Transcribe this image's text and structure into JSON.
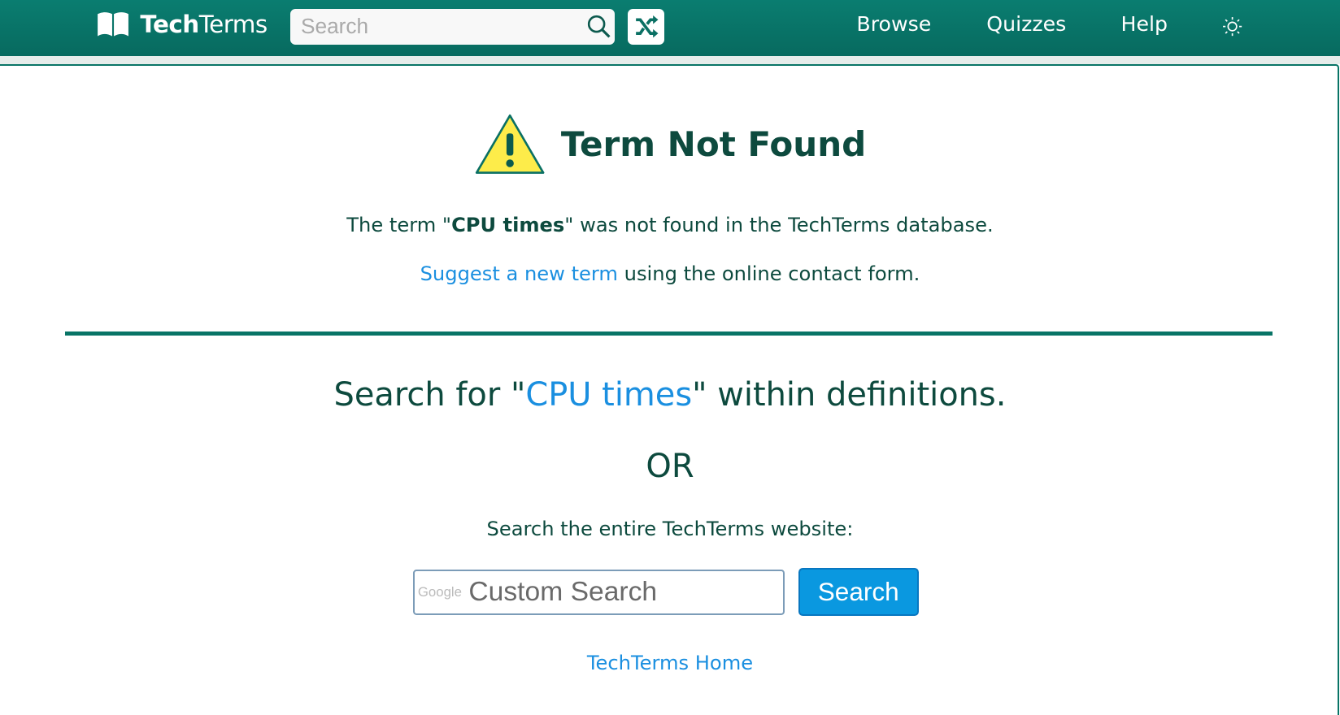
{
  "header": {
    "logo_bold": "Tech",
    "logo_light": "Terms",
    "search_placeholder": "Search",
    "nav": [
      "Browse",
      "Quizzes",
      "Help"
    ],
    "icons": {
      "logo": "book-icon",
      "search": "magnifier-icon",
      "random": "shuffle-icon",
      "theme": "sun-icon"
    }
  },
  "main": {
    "title": "Term Not Found",
    "message_prefix": "The term \"",
    "term": "CPU times",
    "message_suffix": "\" was not found in the TechTerms database.",
    "suggest_link": "Suggest a new term",
    "suggest_suffix": " using the online contact form.",
    "search_for_prefix": "Search for \"",
    "search_for_term": "CPU times",
    "search_for_suffix": "\" within definitions.",
    "or": "OR",
    "search_site_label": "Search the entire TechTerms website:",
    "google_label": "Google",
    "custom_search_placeholder": "Custom Search",
    "search_button": "Search",
    "home_link": "TechTerms Home"
  },
  "colors": {
    "brand": "#087466",
    "link": "#1a8fe0",
    "text": "#0d4a3e",
    "button": "#0a98e0",
    "warning": "#fdec4a"
  }
}
